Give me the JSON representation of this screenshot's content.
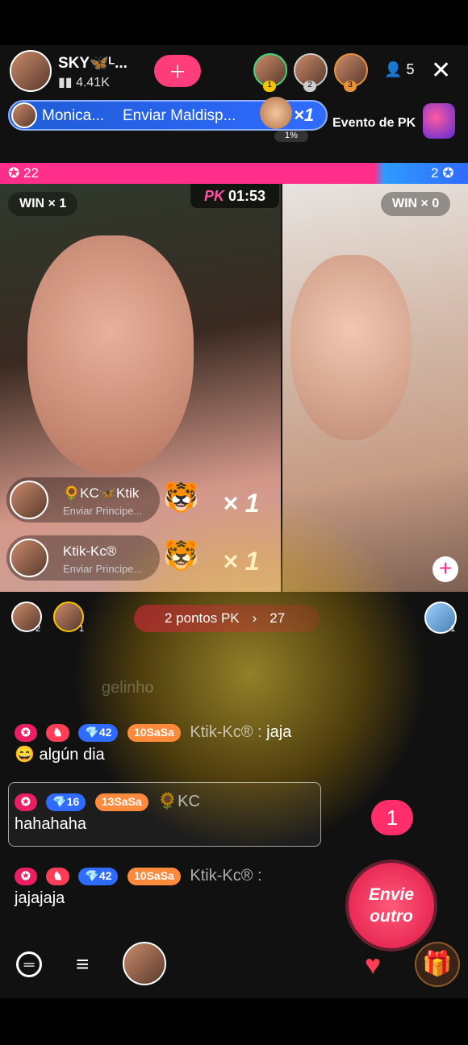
{
  "header": {
    "host_name": "SKY🦋ᴸ...",
    "host_views": "4.41K",
    "viewer_count": "5",
    "ranks": [
      "1",
      "2",
      "3"
    ]
  },
  "banner": {
    "sender": "Monica...",
    "action": "Enviar Maldisp...",
    "multiplier": "×1",
    "percent": "1%",
    "event_label": "Evento de PK"
  },
  "score": {
    "left": "22",
    "right": "2"
  },
  "battle": {
    "left_win": "WIN × 1",
    "right_win": "WIN × 0",
    "pk_logo": "PK",
    "timer": "01:53"
  },
  "gift_notices": [
    {
      "name": "🌻KC🦋Ktik",
      "action": "Enviar Principe...",
      "count": "× 1"
    },
    {
      "name": "Ktik-Kc®",
      "action": "Enviar Principe...",
      "count": "× 1"
    }
  ],
  "pk_points": {
    "label": "2 pontos PK",
    "extra": "27"
  },
  "viewer_badges": {
    "left1": "2",
    "left2": "1",
    "right": "1"
  },
  "faded_line": "gelinho",
  "chat": [
    {
      "level": "42",
      "tag": "SaSa",
      "user": "Ktik-Kc®",
      "text": "jaja",
      "extra": "😄 algún dia"
    },
    {
      "level": "16",
      "tag": "SaSa",
      "user": "🌻KC",
      "text": "hahahaha",
      "extra": ""
    },
    {
      "level": "42",
      "tag": "SaSa",
      "user": "Ktik-Kc®",
      "text": "jajajaja",
      "extra": ""
    }
  ],
  "combo": {
    "count": "1",
    "label": "Envie outro"
  },
  "colors": {
    "pink": "#e91e63",
    "blue": "#2f6bff",
    "gold": "#ffcc00"
  }
}
